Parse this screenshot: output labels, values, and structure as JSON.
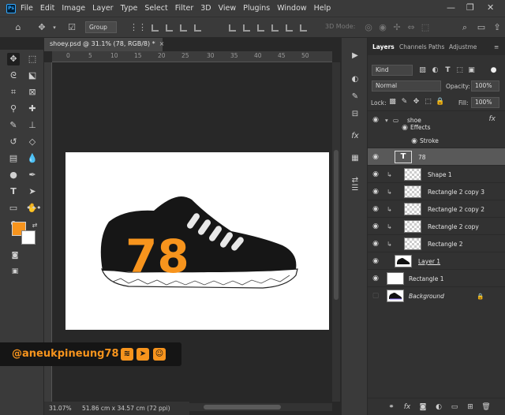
{
  "app": {
    "logo": "Ps"
  },
  "menu": [
    "File",
    "Edit",
    "Image",
    "Layer",
    "Type",
    "Select",
    "Filter",
    "3D",
    "View",
    "Plugins",
    "Window",
    "Help"
  ],
  "window_controls": {
    "minimize": "—",
    "maximize": "❐",
    "close": "✕"
  },
  "options_bar": {
    "auto_select_value": "Group",
    "mode_3d_label": "3D Mode:"
  },
  "document": {
    "tab_title": "shoey.psd @ 31.1% (78, RGB/8) *",
    "tab_close": "×",
    "shoe_number": "78",
    "zoom": "31.07%",
    "size_info": "51.86 cm x 34.57 cm (72 ppi)"
  },
  "ruler_top_ticks": [
    "0",
    "5",
    "10",
    "15",
    "20",
    "25",
    "30",
    "35",
    "40",
    "45",
    "50"
  ],
  "watermark": {
    "handle": "@aneukpineung78",
    "icons": [
      "steemit-icon",
      "telegram-icon",
      "discord-icon"
    ]
  },
  "layers_panel": {
    "tabs": [
      "Layers",
      "Channels",
      "Paths",
      "Adjustme"
    ],
    "filter_kind": "Kind",
    "blend_mode": "Normal",
    "opacity_label": "Opacity:",
    "opacity_value": "100%",
    "lock_label": "Lock:",
    "fill_label": "Fill:",
    "fill_value": "100%",
    "layers": [
      {
        "name": "shoe",
        "kind": "group",
        "fx": "fx",
        "visible": true
      },
      {
        "name": "Effects",
        "kind": "effects",
        "visible": true
      },
      {
        "name": "Stroke",
        "kind": "effect",
        "visible": true
      },
      {
        "name": "78",
        "kind": "text",
        "thumb_label": "T",
        "visible": true,
        "selected": true
      },
      {
        "name": "Shape 1",
        "kind": "shape",
        "visible": true
      },
      {
        "name": "Rectangle 2 copy 3",
        "kind": "clipped",
        "visible": true
      },
      {
        "name": "Rectangle 2 copy 2",
        "kind": "clipped",
        "visible": true
      },
      {
        "name": "Rectangle 2 copy",
        "kind": "clipped",
        "visible": true
      },
      {
        "name": "Rectangle 2",
        "kind": "clipped",
        "visible": true
      },
      {
        "name": "Layer 1",
        "kind": "pixel",
        "visible": true
      },
      {
        "name": "Rectangle 1",
        "kind": "shape",
        "visible": true
      },
      {
        "name": "Background",
        "kind": "background",
        "visible": false,
        "locked": true
      }
    ]
  },
  "colors": {
    "foreground": "#f7941d",
    "background": "#ffffff",
    "accent_orange": "#f7941d"
  }
}
